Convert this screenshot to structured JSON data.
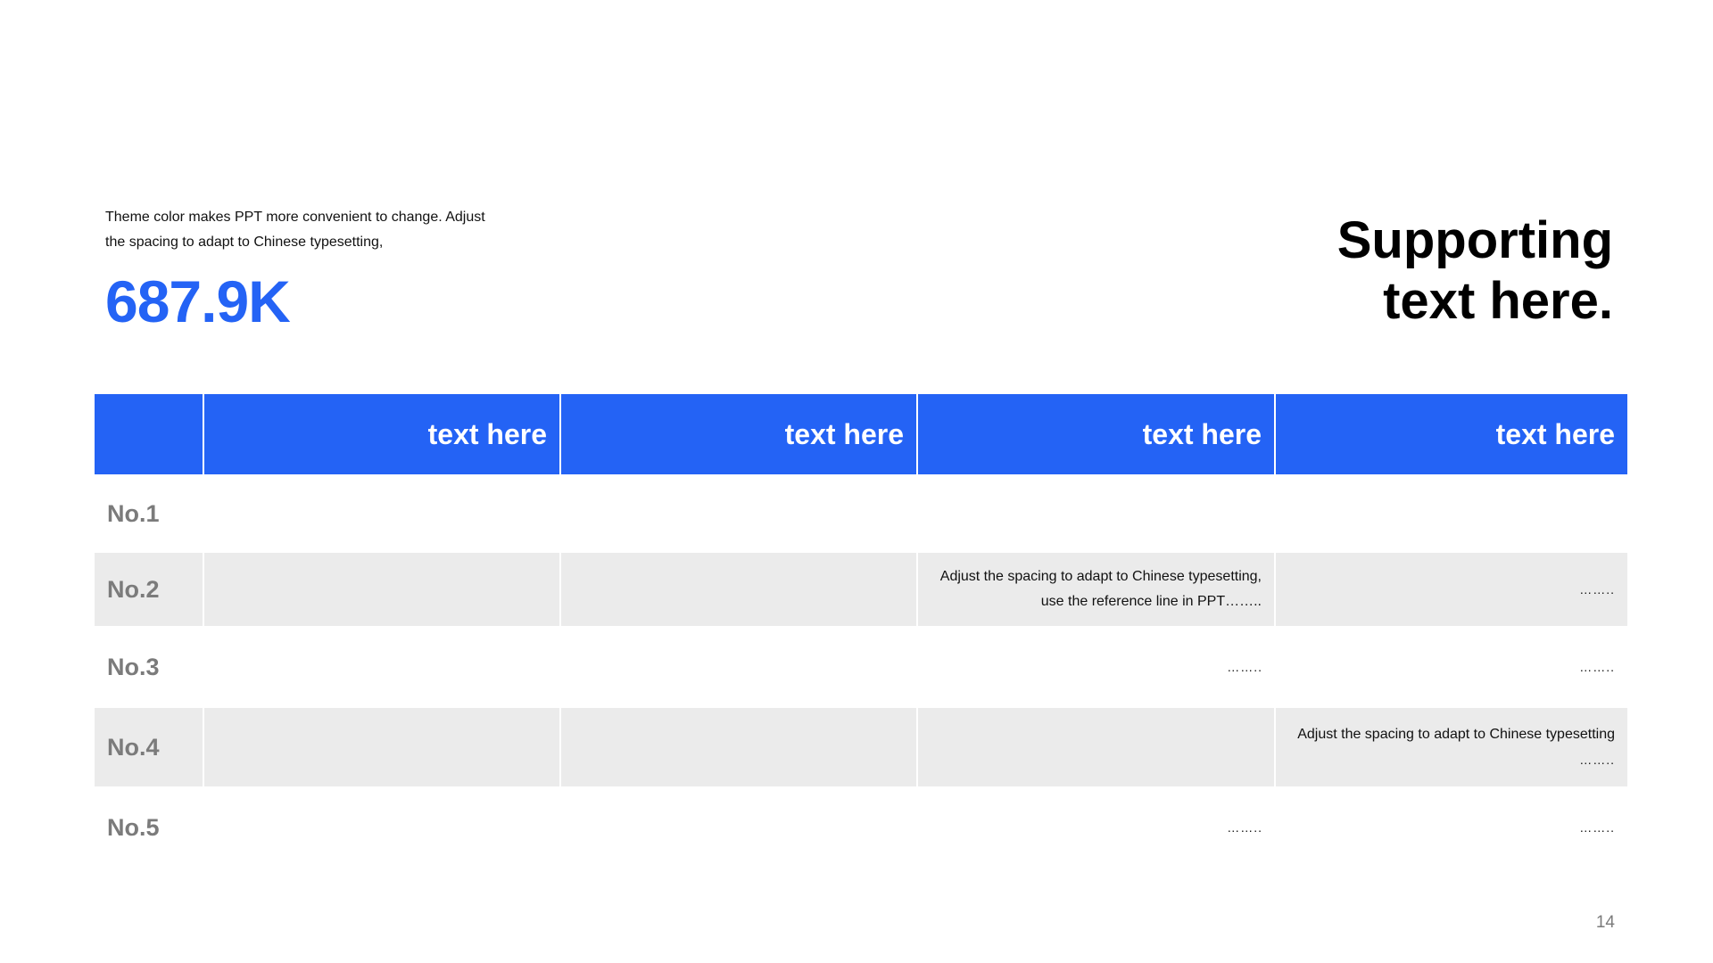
{
  "intro": {
    "line1": "Theme color makes PPT more convenient  to change.  Adjust",
    "line2": "the spacing to adapt to Chinese typesetting,"
  },
  "stat": {
    "value": "687.9K"
  },
  "headline": {
    "line1": "Supporting",
    "line2": "text here."
  },
  "table": {
    "headers": [
      "",
      "text here",
      "text here",
      "text here",
      "text here"
    ],
    "rows": [
      {
        "label": "No.1",
        "cells": [
          "",
          "",
          "",
          ""
        ]
      },
      {
        "label": "No.2",
        "cells": [
          "",
          "",
          "Adjust the spacing to adapt to Chinese typesetting,",
          "……..",
          "use the reference line in PPT…….."
        ]
      },
      {
        "label": "No.3",
        "cells": [
          "",
          "",
          "……..",
          "…….."
        ]
      },
      {
        "label": "No.4",
        "cells": [
          "",
          "",
          "",
          "Adjust the spacing to adapt to Chinese typesetting",
          "…….."
        ]
      },
      {
        "label": "No.5",
        "cells": [
          "",
          "",
          "……..",
          "…….."
        ]
      }
    ]
  },
  "page": {
    "number": "14"
  },
  "colors": {
    "accent": "#2463F5",
    "shade": "#EBEBEB",
    "label": "#7B7B7B"
  }
}
